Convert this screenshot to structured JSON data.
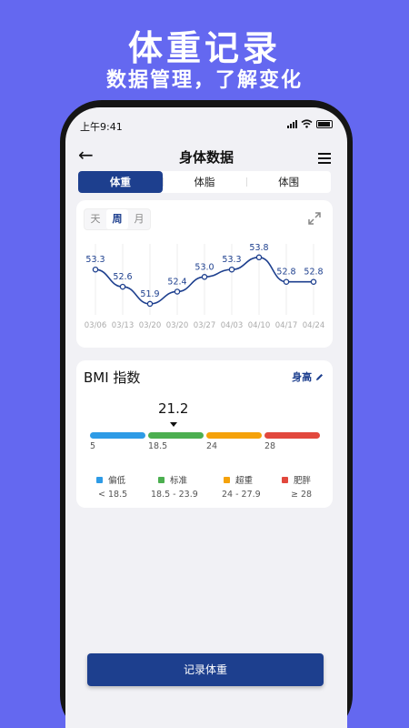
{
  "promo": {
    "title": "体重记录",
    "subtitle": "数据管理，了解变化"
  },
  "status": {
    "time": "上午9:41"
  },
  "header": {
    "title": "身体数据"
  },
  "tabs": [
    {
      "label": "体重",
      "active": true
    },
    {
      "label": "体脂",
      "active": false
    },
    {
      "label": "体围",
      "active": false
    }
  ],
  "period": [
    {
      "label": "天",
      "active": false
    },
    {
      "label": "周",
      "active": true
    },
    {
      "label": "月",
      "active": false
    }
  ],
  "chart_data": {
    "type": "line",
    "x": [
      "03/06",
      "03/13",
      "03/20",
      "03/20",
      "03/27",
      "04/03",
      "04/10",
      "04/17",
      "04/24"
    ],
    "values": [
      53.3,
      52.6,
      51.9,
      52.4,
      53.0,
      53.3,
      53.8,
      52.8,
      52.8
    ],
    "data_labels": [
      "53.3",
      "52.6",
      "51.9",
      "52.4",
      "53.0",
      "53.3",
      "53.8",
      "52.8",
      "52.8"
    ],
    "ylim": [
      51.6,
      54.2
    ],
    "grid": true,
    "color": "#1d3f8e"
  },
  "bmi": {
    "title": "BMI 指数",
    "height_link": "身高",
    "value": "21.2",
    "ticks": [
      "5",
      "18.5",
      "24",
      "28"
    ],
    "categories": [
      {
        "label": "偏低",
        "range": "< 18.5",
        "color": "#2e9be6"
      },
      {
        "label": "标准",
        "range": "18.5 - 23.9",
        "color": "#4caf50"
      },
      {
        "label": "超重",
        "range": "24 - 27.9",
        "color": "#f5a20a"
      },
      {
        "label": "肥胖",
        "range": "≥ 28",
        "color": "#e2483d"
      }
    ]
  },
  "actions": {
    "record_label": "记录体重"
  }
}
